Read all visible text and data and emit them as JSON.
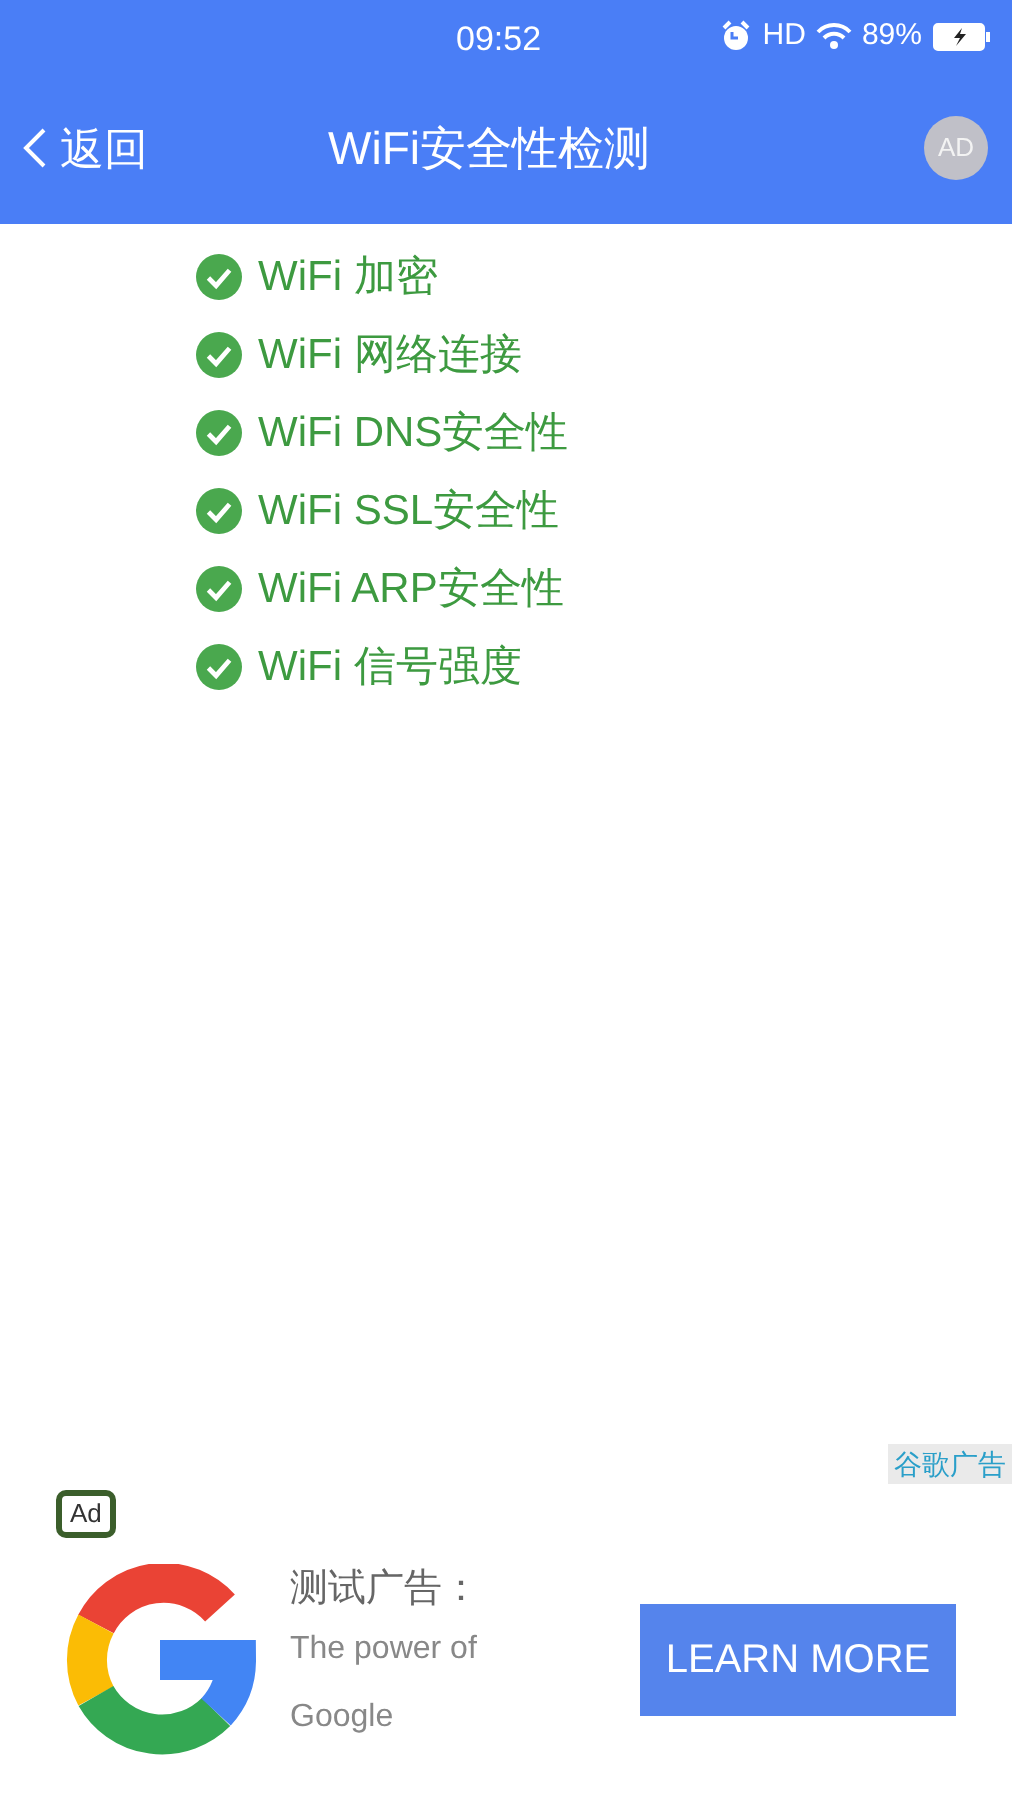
{
  "status_bar": {
    "time": "09:52",
    "network": "HD",
    "battery": "89%"
  },
  "nav": {
    "back": "返回",
    "title": "WiFi安全性检测",
    "badge": "AD"
  },
  "checks": [
    {
      "label": "WiFi 加密",
      "checked": true
    },
    {
      "label": "WiFi 网络连接",
      "checked": true
    },
    {
      "label": "WiFi DNS安全性",
      "checked": true
    },
    {
      "label": "WiFi SSL安全性",
      "checked": true
    },
    {
      "label": "WiFi ARP安全性",
      "checked": true
    },
    {
      "label": "WiFi 信号强度",
      "checked": true
    }
  ],
  "ad": {
    "source": "谷歌广告",
    "badge": "Ad",
    "title": "测试广告：",
    "text": "The power of Google",
    "button": "LEARN MORE"
  }
}
